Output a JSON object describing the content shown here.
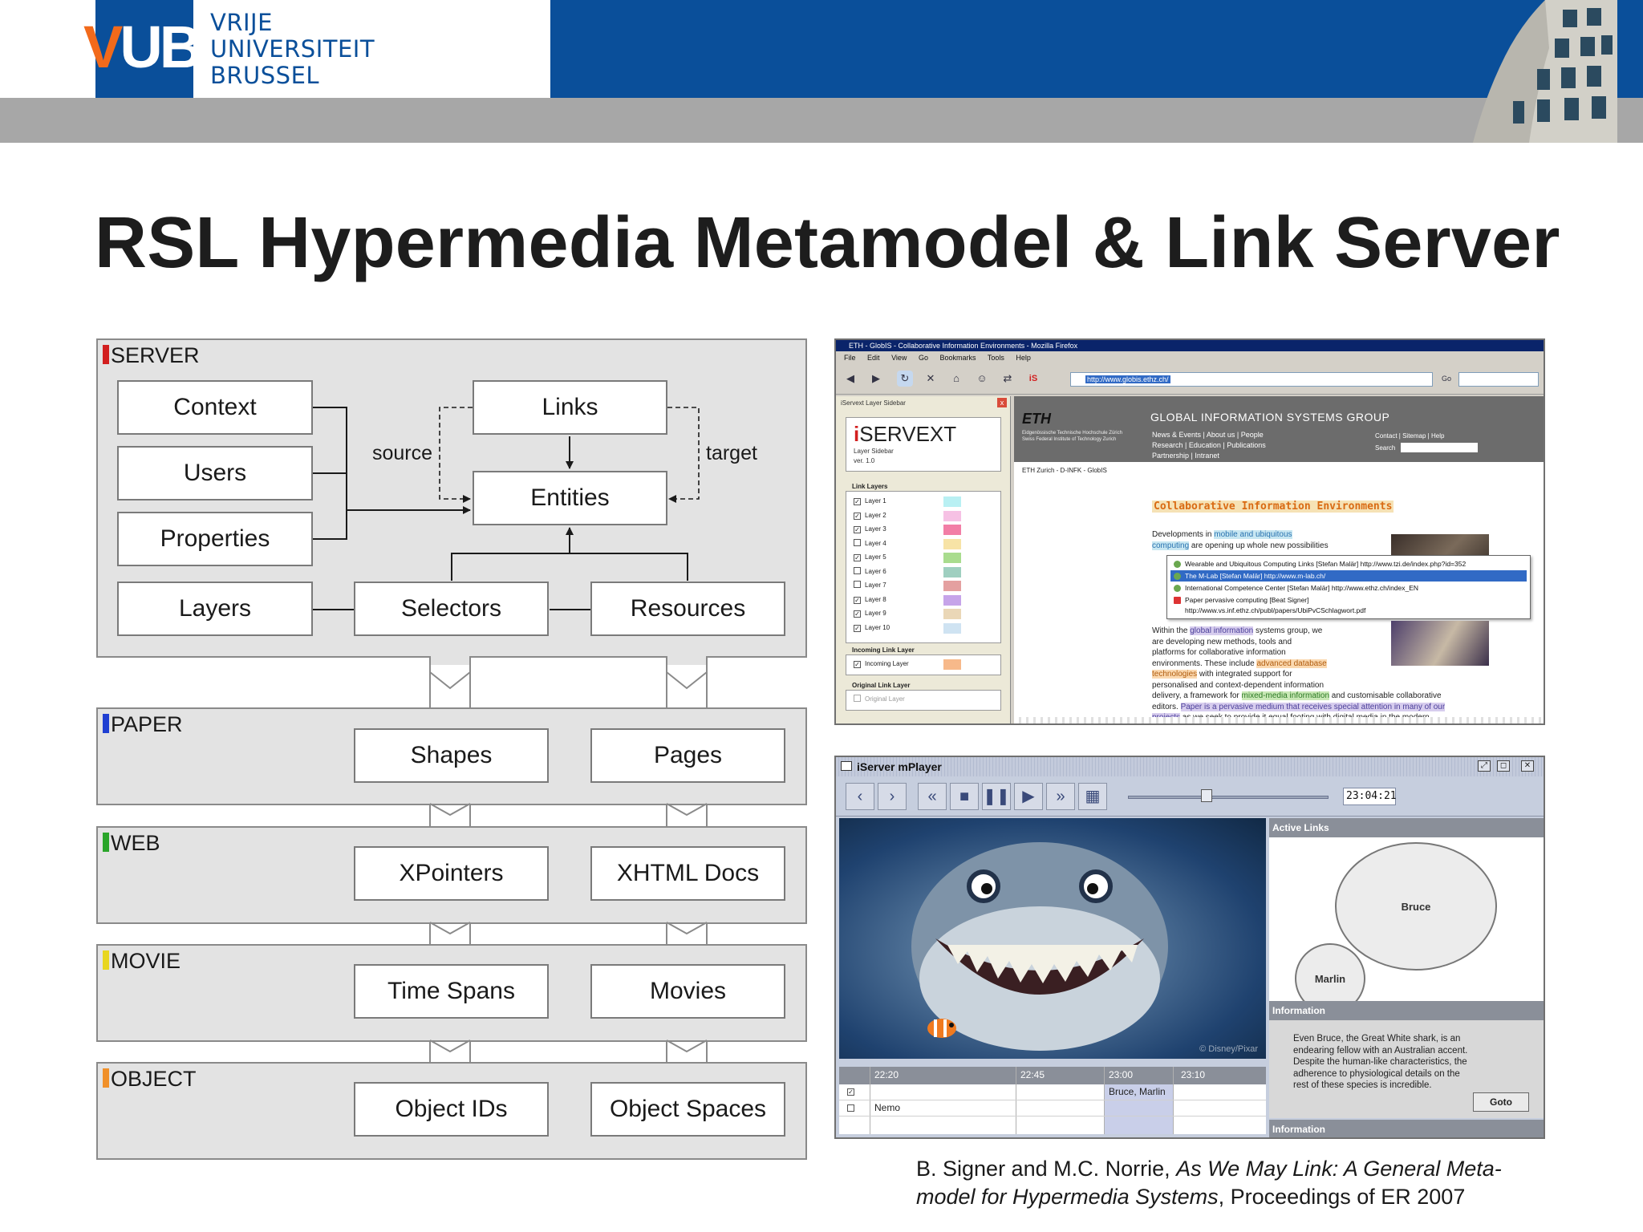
{
  "header": {
    "logo_mark": "VUB",
    "logo_lines": [
      "VRIJE",
      "UNIVERSITEIT",
      "BRUSSEL"
    ],
    "colors": {
      "blue": "#0a4f9a",
      "gray_band": "#a7a7a7",
      "orange": "#f26a1b"
    }
  },
  "title": "RSL Hypermedia Metamodel & Link Server",
  "diagram": {
    "layers": [
      {
        "name": "SERVER",
        "i_color": "#d21f1f"
      },
      {
        "name": "PAPER",
        "i_color": "#1f3fd2"
      },
      {
        "name": "WEB",
        "i_color": "#2aa52a"
      },
      {
        "name": "MOVIE",
        "i_color": "#e8d61f"
      },
      {
        "name": "OBJECT",
        "i_color": "#f0902a"
      }
    ],
    "server_boxes": [
      "Context",
      "Users",
      "Properties",
      "Layers",
      "Links",
      "Entities",
      "Selectors",
      "Resources"
    ],
    "edge_labels": {
      "source": "source",
      "target": "target"
    },
    "paper": [
      "Shapes",
      "Pages"
    ],
    "web": [
      "XPointers",
      "XHTML Docs"
    ],
    "movie": [
      "Time Spans",
      "Movies"
    ],
    "object": [
      "Object IDs",
      "Object Spaces"
    ]
  },
  "browser": {
    "window_title": "ETH - GlobIS - Collaborative Information Environments - Mozilla Firefox",
    "menu": [
      "File",
      "Edit",
      "View",
      "Go",
      "Bookmarks",
      "Tools",
      "Help"
    ],
    "url": "http://www.globis.ethz.ch/",
    "go_label": "Go",
    "sidebar": {
      "title": "iServext Layer Sidebar",
      "brand": "SERVEXT",
      "sub1": "Layer Sidebar",
      "sub2": "ver. 1.0",
      "link_layers_label": "Link Layers",
      "layers": [
        {
          "label": "Layer 1",
          "checked": "✓",
          "color": "#b9f0f3"
        },
        {
          "label": "Layer 2",
          "checked": "✓",
          "color": "#f6c1e4"
        },
        {
          "label": "Layer 3",
          "checked": "✓",
          "color": "#f27ea6"
        },
        {
          "label": "Layer 4",
          "checked": "",
          "color": "#f7e3a6"
        },
        {
          "label": "Layer 5",
          "checked": "✓",
          "color": "#a9dc8e"
        },
        {
          "label": "Layer 6",
          "checked": "",
          "color": "#9fcfc0"
        },
        {
          "label": "Layer 7",
          "checked": "",
          "color": "#e4a0a0"
        },
        {
          "label": "Layer 8",
          "checked": "✓",
          "color": "#c6a4e9"
        },
        {
          "label": "Layer 9",
          "checked": "✓",
          "color": "#ead7b7"
        },
        {
          "label": "Layer 10",
          "checked": "✓",
          "color": "#cfe3f2"
        }
      ],
      "incoming_label": "Incoming Link Layer",
      "incoming_item": "Incoming Layer",
      "incoming_color": "#f7b98a",
      "original_label": "Original Link Layer",
      "original_item": "Original Layer"
    },
    "page": {
      "eth_logo": "ETH",
      "eth_small": [
        "Eidgenössische Technische Hochschule Zürich",
        "Swiss Federal Institute of Technology Zurich"
      ],
      "group_title": "GLOBAL INFORMATION SYSTEMS GROUP",
      "nav": [
        "News & Events | About us | People",
        "Research | Education | Publications",
        "Partnership | Intranet"
      ],
      "right_nav": [
        "Contact | Sitemap | Help",
        "Search"
      ],
      "breadcrumb": "ETH Zurich - D-INFK - GlobIS",
      "heading": "Collaborative Information Environments",
      "para1": {
        "a": "Developments in ",
        "b": "mobile and ubiquitous",
        "c": "computing",
        "d": " are opening up whole new possibilities"
      },
      "popup": [
        "Wearable and Ubiquitous Computing Links [Stefan Malär] http://www.tzi.de/index.php?id=352",
        "The M-Lab [Stefan Malär] http://www.m-lab.ch/",
        "International Competence Center [Stefan Malär] http://www.ethz.ch/index_EN",
        "Paper pervasive computing [Beat Signer]",
        "http://www.vs.inf.ethz.ch/publ/papers/UbiPvCSchlagwort.pdf"
      ],
      "para2": [
        [
          "Within the ",
          "global information",
          " systems group, we"
        ],
        [
          "are developing new methods, tools and",
          "",
          ""
        ],
        [
          "platforms for collaborative information",
          "",
          ""
        ],
        [
          "environments. These include ",
          "advanced database",
          ""
        ],
        [
          "technologies",
          " with integrated support for",
          ""
        ],
        [
          "personalised and context-dependent information",
          "",
          ""
        ],
        [
          "delivery, a framework for ",
          "mixed-media information",
          " and customisable collaborative"
        ],
        [
          "editors. ",
          "Paper is a pervasive medium that receives special attention in many of our",
          ""
        ],
        [
          "projects",
          " as we seek to provide it equal footing with digital media in the modern",
          ""
        ]
      ]
    }
  },
  "player": {
    "title": "iServer mPlayer",
    "time": "23:04:21",
    "slider_fraction": 0.39,
    "active_links_label": "Active Links",
    "links": [
      "Bruce",
      "Marlin"
    ],
    "info_label": "Information",
    "info_text": [
      "Even Bruce, the Great White shark, is an",
      "endearing fellow with an Australian accent.",
      "Despite the human-like characteristics, the",
      "adherence to physiological details on the",
      "rest of these species is incredible."
    ],
    "goto_label": "Goto",
    "info2_label": "Information",
    "copyright": "© Disney/Pixar",
    "timeline_ticks": [
      "22:20",
      "22:45",
      "23:00",
      "23:10"
    ],
    "timeline_rows": [
      {
        "check": "✓",
        "label": "",
        "clip": "Bruce, Marlin"
      },
      {
        "check": "",
        "label": "Nemo",
        "clip": ""
      }
    ]
  },
  "citation": {
    "authors": "B. Signer and M.C. Norrie, ",
    "title_line1": "As We May Link: A General Meta-",
    "title_line2": "model for Hypermedia Systems",
    "venue": ", Proceedings of ER 2007"
  }
}
